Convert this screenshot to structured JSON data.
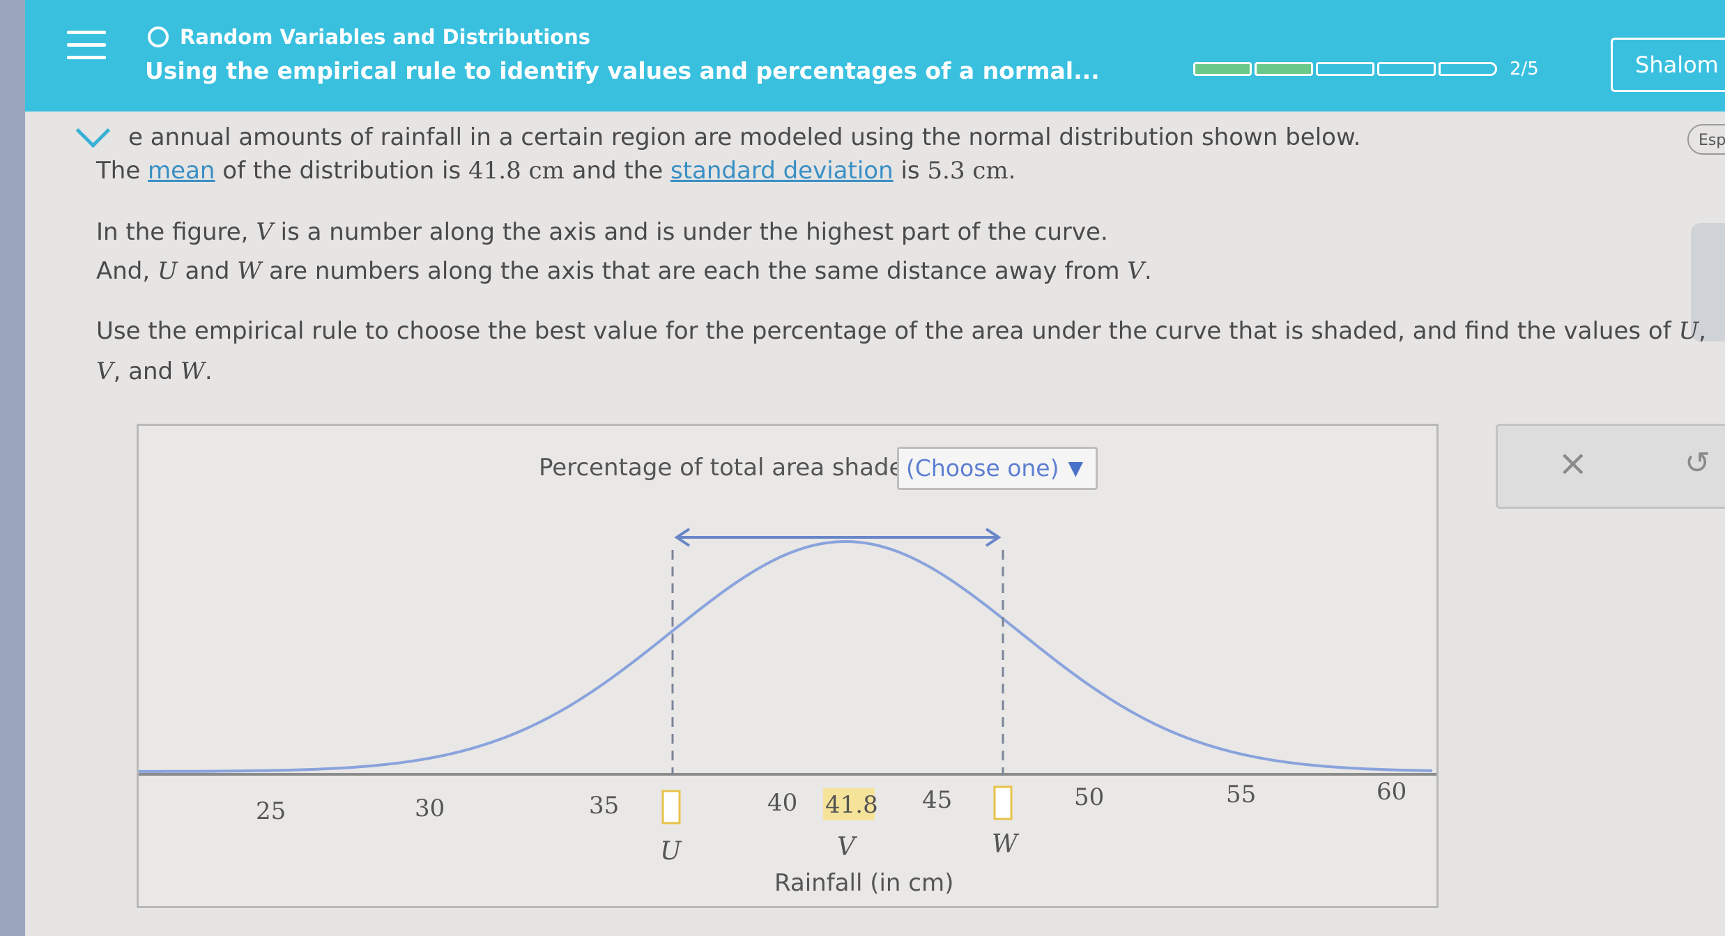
{
  "header": {
    "topic": "Random Variables and Distributions",
    "subtitle": "Using the empirical rule to identify values and percentages of a normal...",
    "progress_text": "2/5",
    "progress_filled": 2,
    "progress_total": 5,
    "user_name": "Shalom"
  },
  "language_button": "Esp",
  "problem": {
    "line1_text": "e annual amounts of rainfall in a certain region are modeled using the normal distribution shown below.",
    "line2_pre": "The ",
    "line2_link1": "mean",
    "line2_mid": " of the distribution is ",
    "mean_value": "41.8 cm",
    "line2_mid2": " and the ",
    "line2_link2": "standard deviation",
    "line2_mid3": " is ",
    "sd_value": "5.3 cm",
    "line2_end": ".",
    "line3_pre": "In the figure, ",
    "var_v": "V",
    "line3_post": " is a number along the axis and is under the highest part of the curve.",
    "line4_pre": "And, ",
    "var_u": "U",
    "line4_and": " and ",
    "var_w": "W",
    "line4_post": " are numbers along the axis that are each the same distance away from ",
    "line4_end": ".",
    "line5": "Use the empirical rule to choose the best value for the percentage of the area under the curve that is shaded, and find the values of ",
    "line5_end": ",",
    "line6_sep": ", and ",
    "line6_end": "."
  },
  "graph": {
    "pct_label": "Percentage of total area shaded:",
    "dropdown_value": "(Choose one)",
    "ticks": [
      "25",
      "30",
      "35",
      "40",
      "41.8",
      "45",
      "50",
      "55",
      "60"
    ],
    "var_labels": [
      "U",
      "V",
      "W"
    ],
    "axis_label": "Rainfall (in cm)",
    "curve_color": "#8aa3dd",
    "highlight_color": "#f6e39a",
    "input_box_color": "#e8c24a"
  }
}
